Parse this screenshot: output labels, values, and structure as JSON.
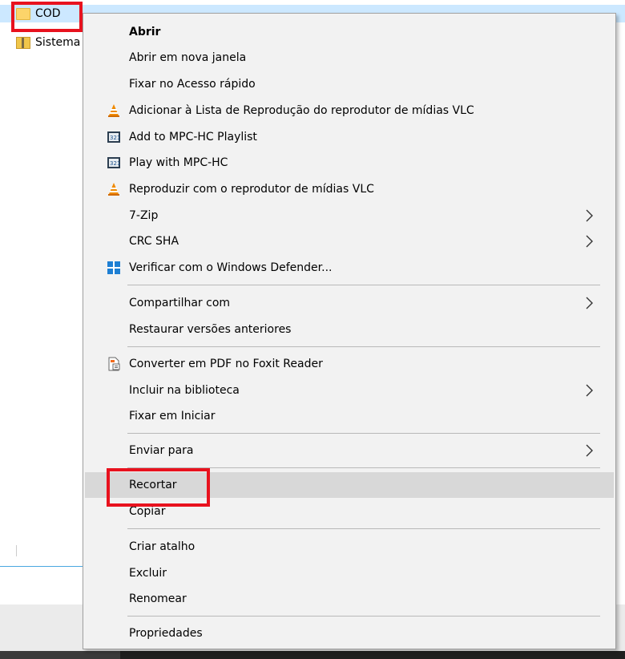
{
  "explorer": {
    "selected_folder": "COD",
    "second_folder": "Sistema"
  },
  "menu": {
    "items": [
      {
        "label": "Abrir",
        "bold": true
      },
      {
        "label": "Abrir em nova janela"
      },
      {
        "label": "Fixar no Acesso rápido"
      },
      {
        "label": "Adicionar à Lista de Reprodução do reprodutor de mídias VLC",
        "icon": "vlc-cone-icon"
      },
      {
        "label": "Add to MPC-HC Playlist",
        "icon": "mpc-hc-icon"
      },
      {
        "label": "Play with MPC-HC",
        "icon": "mpc-hc-icon"
      },
      {
        "label": "Reproduzir com o reprodutor de mídias VLC",
        "icon": "vlc-cone-icon"
      },
      {
        "label": "7-Zip",
        "submenu": true
      },
      {
        "label": "CRC SHA",
        "submenu": true
      },
      {
        "label": "Verificar com o Windows Defender...",
        "icon": "windows-defender-icon"
      },
      {
        "label": "Compartilhar com",
        "submenu": true
      },
      {
        "label": "Restaurar versões anteriores"
      },
      {
        "label": "Converter em PDF no Foxit Reader",
        "icon": "foxit-pdf-icon"
      },
      {
        "label": "Incluir na biblioteca",
        "submenu": true
      },
      {
        "label": "Fixar em Iniciar"
      },
      {
        "label": "Enviar para",
        "submenu": true
      },
      {
        "label": "Recortar",
        "highlighted": true
      },
      {
        "label": "Copiar"
      },
      {
        "label": "Criar atalho"
      },
      {
        "label": "Excluir"
      },
      {
        "label": "Renomear"
      },
      {
        "label": "Propriedades"
      }
    ]
  },
  "colors": {
    "selection": "#cce8ff",
    "menu_bg": "#f2f2f2",
    "hover": "#d8d8d8",
    "annotation": "#e8121e"
  }
}
